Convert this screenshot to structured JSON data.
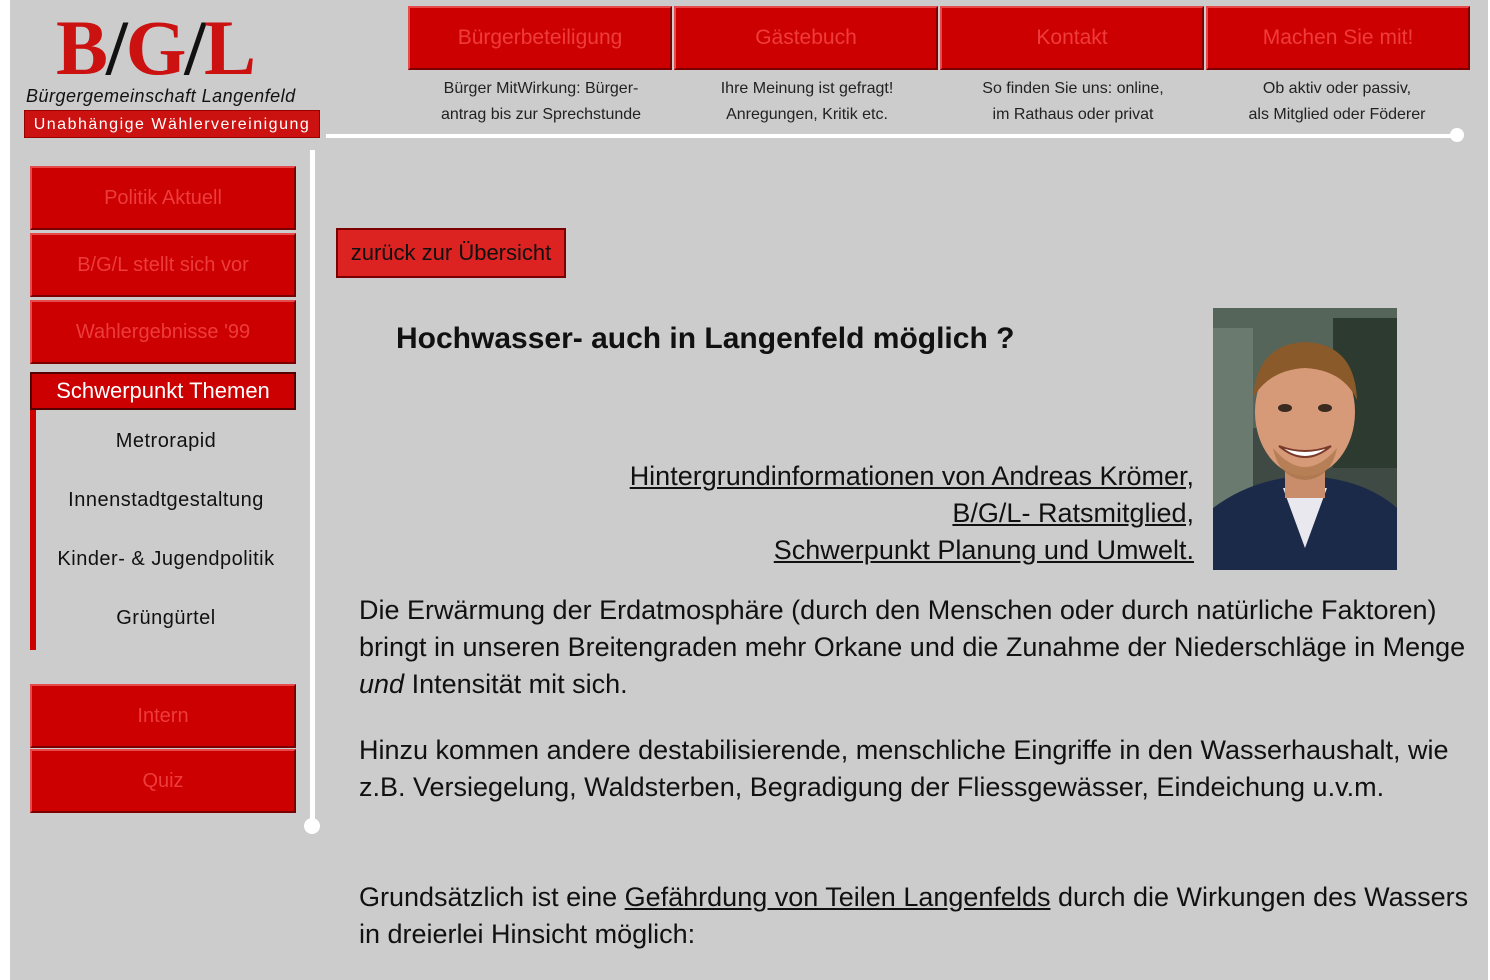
{
  "logo": {
    "mark_b": "B",
    "mark_g": "G",
    "mark_l": "L",
    "slash": "/",
    "subtitle": "Bürgergemeinschaft Langenfeld",
    "badge": "Unabhängige Wählervereinigung"
  },
  "topnav": [
    {
      "label": "Bürgerbeteiligung",
      "desc1": "Bürger MitWirkung: Bürger-",
      "desc2": "antrag bis zur Sprechstunde"
    },
    {
      "label": "Gästebuch",
      "desc1": "Ihre Meinung ist gefragt!",
      "desc2": "Anregungen, Kritik etc."
    },
    {
      "label": "Kontakt",
      "desc1": "So finden Sie uns: online,",
      "desc2": "im Rathaus oder privat"
    },
    {
      "label": "Machen Sie mit!",
      "desc1": "Ob aktiv oder passiv,",
      "desc2": "als Mitglied oder Föderer"
    }
  ],
  "sidebar": {
    "buttons": [
      "Politik Aktuell",
      "B/G/L stellt sich vor",
      "Wahlergebnisse '99"
    ],
    "active": "Schwerpunkt Themen",
    "subitems": [
      "Metrorapid",
      "Innenstadtgestaltung",
      "Kinder- & Jugendpolitik",
      "Grüngürtel"
    ],
    "bottom_buttons": [
      "Intern",
      "Quiz"
    ]
  },
  "content": {
    "back_button": "zurück zur Übersicht",
    "headline": "Hochwasser- auch in Langenfeld möglich ?",
    "links": [
      "Hintergrundinformationen von Andreas Krömer,",
      "B/G/L- Ratsmitglied,",
      "Schwerpunkt Planung und Umwelt."
    ],
    "p1_a": "Die Erwärmung der Erdatmosphäre (durch den Menschen oder durch natürliche Faktoren) bringt in unseren Breitengraden mehr Orkane und die Zunahme der Niederschläge in Menge ",
    "p1_em": "und",
    "p1_b": " Intensität mit sich.",
    "p2": "Hinzu kommen andere destabilisierende, menschliche Eingriffe in den Wasserhaushalt, wie z.B. Versiegelung, Waldsterben, Begradigung  der Fliessgewässer, Eindeichung u.v.m.",
    "p3_a": "Grundsätzlich ist eine ",
    "p3_link": "Gefährdung von Teilen Langenfelds",
    "p3_b": " durch die Wirkungen des Wassers in dreierlei Hinsicht möglich:"
  }
}
